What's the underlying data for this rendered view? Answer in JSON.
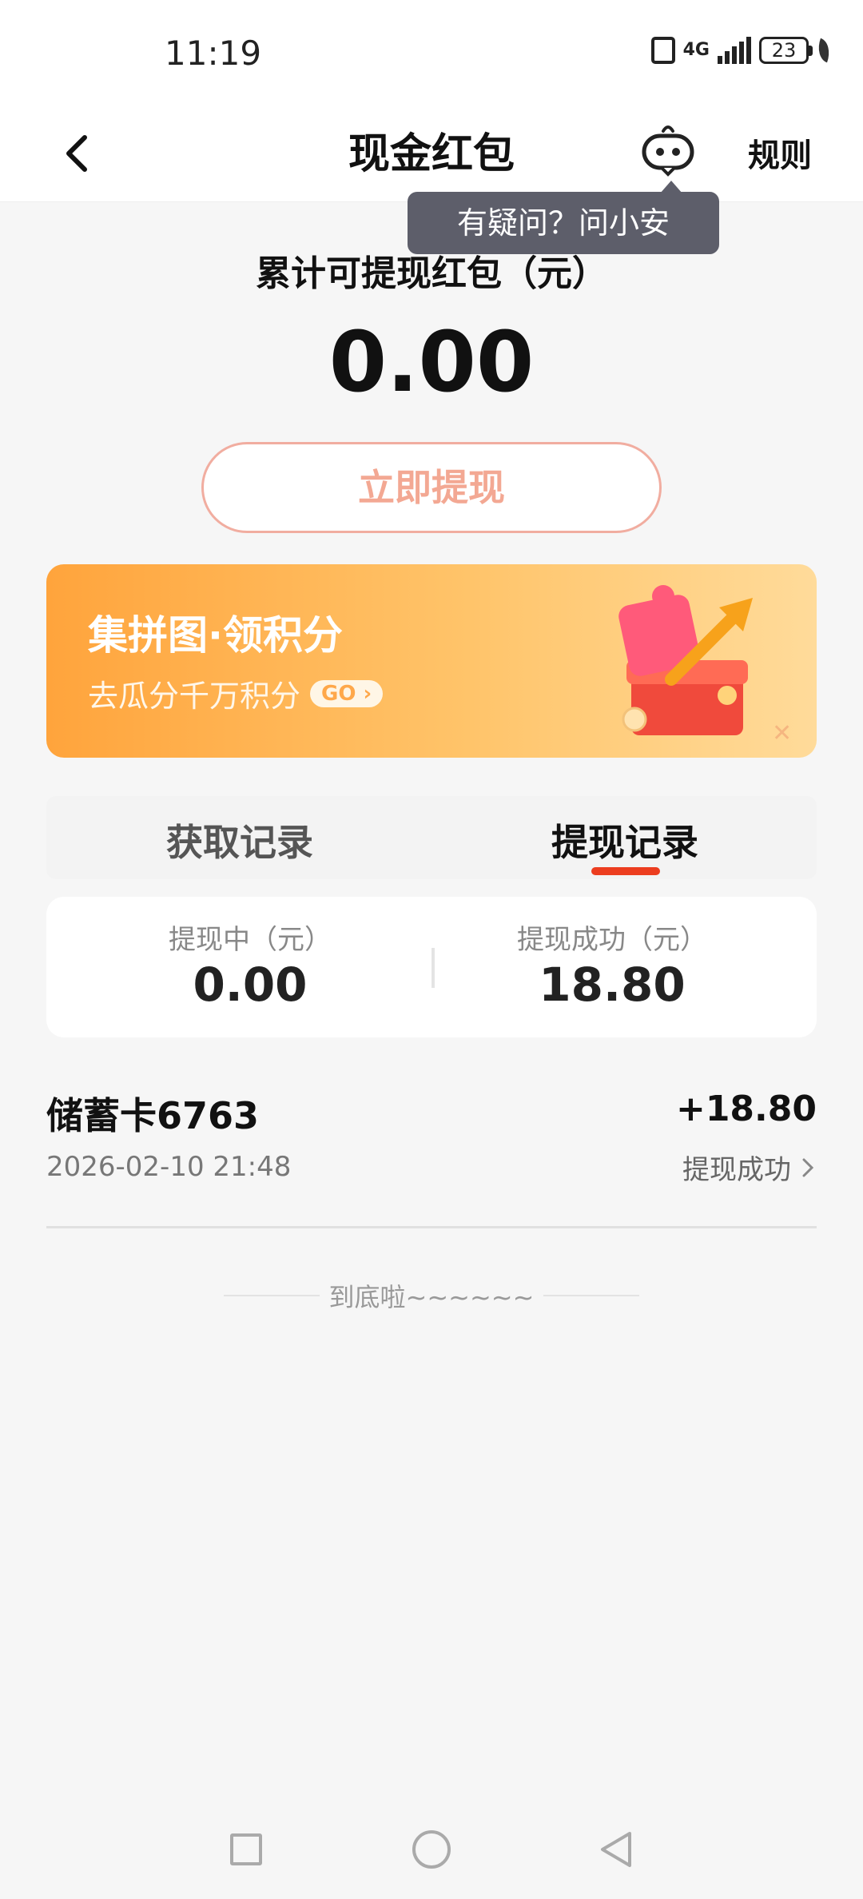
{
  "status_bar": {
    "time": "11:19",
    "network": "4G",
    "battery": "23"
  },
  "header": {
    "title": "现金红包",
    "rules_label": "规则",
    "tooltip": "有疑问？问小安"
  },
  "summary": {
    "label": "累计可提现红包（元）",
    "amount": "0.00",
    "withdraw_button": "立即提现"
  },
  "banner": {
    "title": "集拼图·领积分",
    "subtitle": "去瓜分千万积分",
    "go_label": "GO",
    "close_icon": "close-icon"
  },
  "tabs": {
    "items": [
      {
        "label": "获取记录",
        "active": false
      },
      {
        "label": "提现记录",
        "active": true
      }
    ]
  },
  "stats": {
    "pending_label": "提现中（元）",
    "pending_value": "0.00",
    "success_label": "提现成功（元）",
    "success_value": "18.80"
  },
  "records": [
    {
      "title": "储蓄卡6763",
      "date": "2026-02-10 21:48",
      "amount": "+18.80",
      "status": "提现成功"
    }
  ],
  "footer": {
    "end_text": "到底啦~~~~~~"
  },
  "colors": {
    "accent": "#ec3d1f",
    "button_outline": "#f1ada0",
    "banner_start": "#ffa43c",
    "banner_end": "#ffdb9a",
    "tooltip_bg": "#5d5e6a"
  }
}
